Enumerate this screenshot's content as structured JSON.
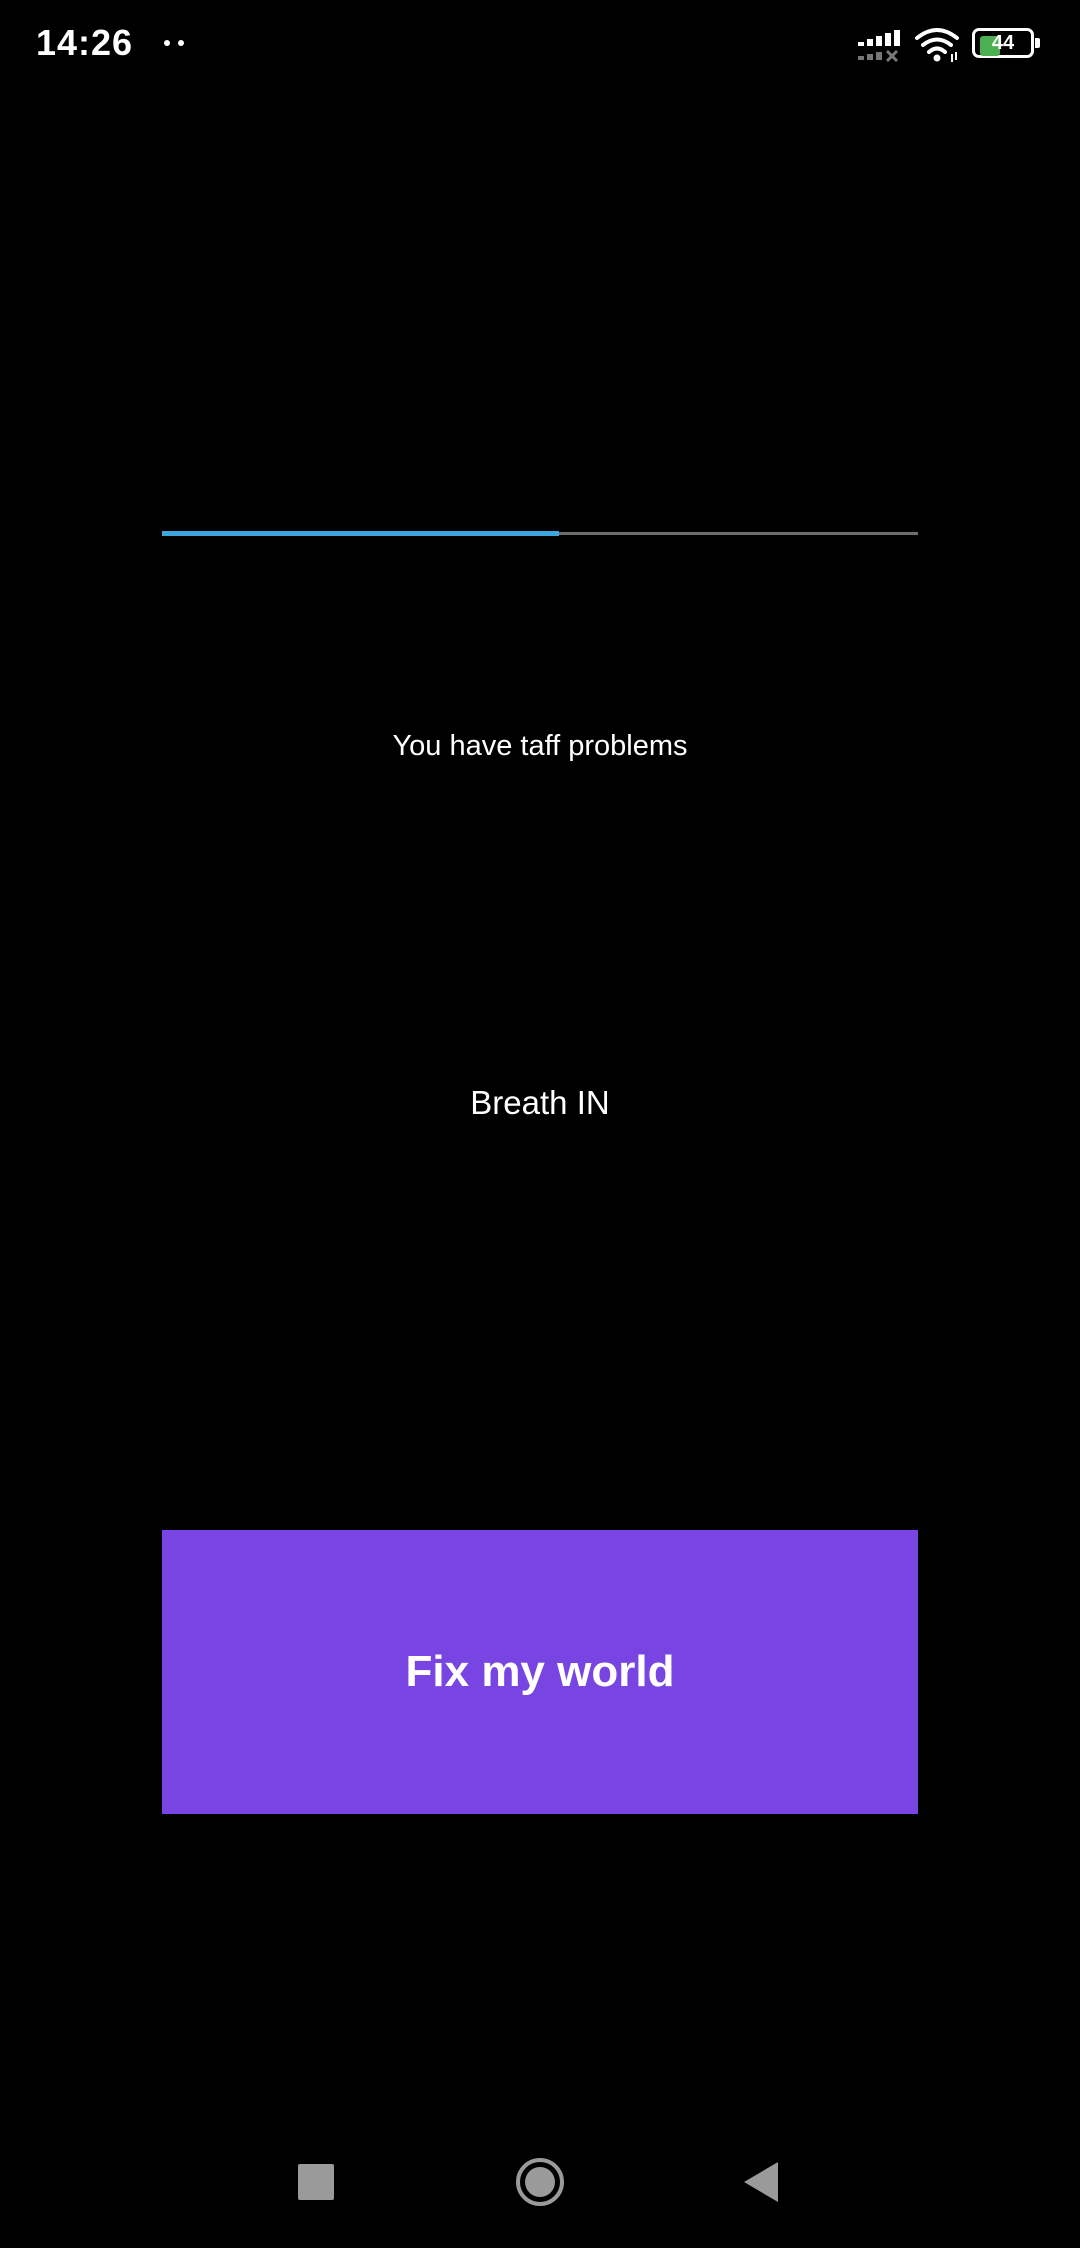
{
  "status_bar": {
    "time": "14:26",
    "battery_level": "44",
    "battery_fraction": 0.44,
    "icons": [
      "notification-dots-icon",
      "signal-icon",
      "wifi-icon",
      "battery-icon"
    ]
  },
  "progress": {
    "fraction": 0.525,
    "fill_color": "#3fa6dd",
    "track_color": "#6e6e6e"
  },
  "message": "You have taff problems",
  "breath_status": "Breath IN",
  "fix_button": {
    "label": "Fix my world",
    "color": "#7845e2"
  },
  "nav_bar": {
    "icons": [
      "recent-apps-icon",
      "home-icon",
      "back-icon"
    ]
  }
}
